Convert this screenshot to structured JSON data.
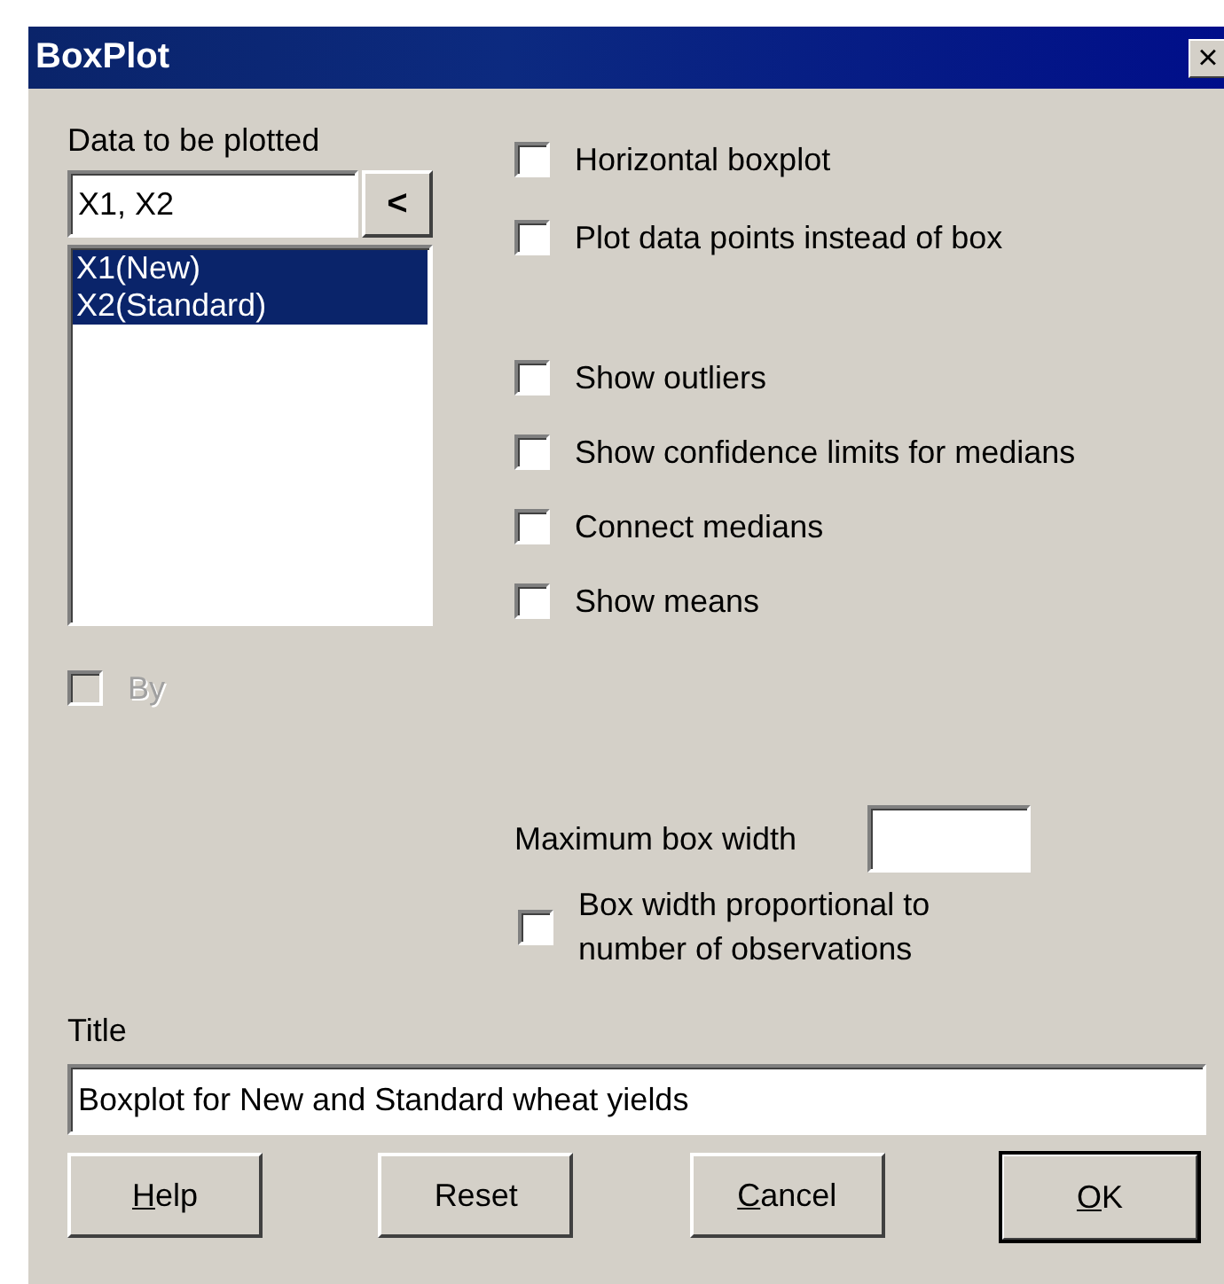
{
  "window": {
    "title": "BoxPlot",
    "close": "×"
  },
  "data": {
    "label": "Data to be plotted",
    "value": "X1, X2",
    "add_button": "<",
    "items": [
      {
        "label": "X1(New)",
        "selected": true
      },
      {
        "label": "X2(Standard)",
        "selected": true
      }
    ],
    "by": {
      "label": "By",
      "checked": false,
      "disabled": true
    }
  },
  "plot_options": [
    {
      "label": "Horizontal boxplot",
      "checked": false
    },
    {
      "label": "Plot data points instead of box",
      "checked": false
    }
  ],
  "display_options": [
    {
      "label": "Show outliers",
      "checked": false
    },
    {
      "label": "Show confidence limits for medians",
      "checked": false
    },
    {
      "label": "Connect medians",
      "checked": false
    },
    {
      "label": "Show means",
      "checked": false
    }
  ],
  "box_width": {
    "label": "Maximum box width",
    "proportional": {
      "label": "Box width proportional to number of observations",
      "checked": false
    }
  },
  "title": {
    "label": "Title",
    "value": "Boxplot for New and Standard wheat yields"
  },
  "buttons": [
    {
      "label": "Help",
      "underline_first": true,
      "default": false
    },
    {
      "label": "Reset",
      "underline_first": false,
      "default": false
    },
    {
      "label": "Cancel",
      "underline_first": true,
      "default": false
    },
    {
      "label": "OK",
      "underline_first": true,
      "default": true
    }
  ]
}
